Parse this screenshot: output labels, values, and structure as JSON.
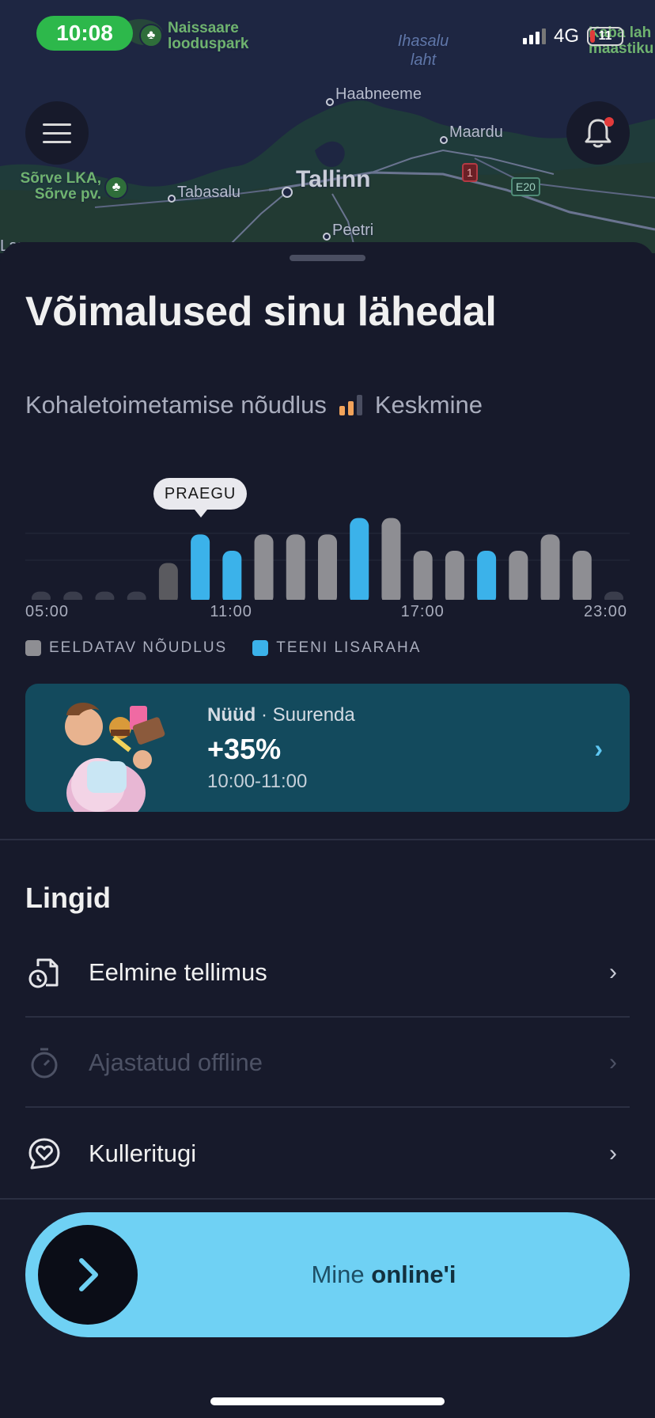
{
  "status_bar": {
    "time": "10:08",
    "network": "4G",
    "battery": "11"
  },
  "map": {
    "labels": {
      "naissaare": "Naissaare looduspark",
      "ihasalu": "Ihasalu laht",
      "haabneeme": "Haabneeme",
      "maardu": "Maardu",
      "tallinn": "Tallinn",
      "tabasalu": "Tabasalu",
      "sorve": "Sõrve LKA, Sõrve pv.",
      "peetri": "Peetri",
      "right_edge": "Kaba lah maastiku",
      "left_edge": "Lau"
    },
    "road_badges": {
      "red": "1",
      "green": "E20"
    }
  },
  "sheet": {
    "title": "Võimalused sinu lähedal",
    "demand_label": "Kohaletoimetamise nõudlus",
    "demand_level": "Keskmine",
    "tooltip": "PRAEGU",
    "legend": {
      "expected": "EELDATAV NÕUDLUS",
      "earn_more": "TEENI LISARAHA"
    },
    "promo": {
      "now": "Nüüd",
      "action": "· Suurenda",
      "value": "+35%",
      "time": "10:00-11:00"
    },
    "links_title": "Lingid",
    "links": [
      {
        "label": "Eelmine tellimus",
        "enabled": true,
        "icon": "receipt-clock-icon"
      },
      {
        "label": "Ajastatud offline",
        "enabled": false,
        "icon": "stopwatch-icon"
      },
      {
        "label": "Kulleritugi",
        "enabled": true,
        "icon": "heart-chat-icon"
      }
    ],
    "go_online": {
      "part1": "Mine",
      "part2": "online'i"
    }
  },
  "colors": {
    "accent_blue": "#3bb2ea",
    "bar_gray": "#8e8e93",
    "bar_dark": "#5a5a5f",
    "online_button": "#6fd1f4",
    "promo_bg": "#134a5d"
  },
  "chart_data": {
    "type": "bar",
    "categories": [
      "05:00",
      "06:00",
      "07:00",
      "08:00",
      "09:00",
      "10:00",
      "11:00",
      "12:00",
      "13:00",
      "14:00",
      "15:00",
      "16:00",
      "17:00",
      "18:00",
      "19:00",
      "20:00",
      "21:00",
      "22:00",
      "23:00"
    ],
    "x_tick_labels": [
      "05:00",
      "11:00",
      "17:00",
      "23:00"
    ],
    "values": [
      0.1,
      0.1,
      0.1,
      0.1,
      0.45,
      0.8,
      0.6,
      0.8,
      0.8,
      0.8,
      1.0,
      1.0,
      0.6,
      0.6,
      0.6,
      0.6,
      0.8,
      0.6,
      0.1
    ],
    "highlight": [
      "none",
      "none",
      "none",
      "none",
      "past",
      "boost",
      "boost",
      "expected",
      "expected",
      "expected",
      "boost",
      "expected",
      "expected",
      "expected",
      "boost",
      "expected",
      "expected",
      "expected",
      "none"
    ],
    "current_index": 5,
    "series": [
      {
        "name": "EELDATAV NÕUDLUS",
        "color": "#8e8e93"
      },
      {
        "name": "TEENI LISARAHA",
        "color": "#3bb2ea"
      }
    ],
    "ylim": [
      0,
      1.2
    ]
  }
}
